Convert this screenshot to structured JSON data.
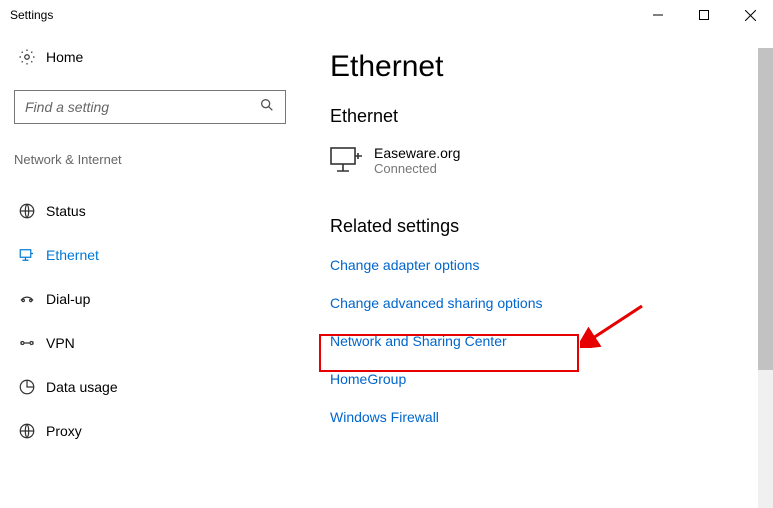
{
  "window_title": "Settings",
  "home_label": "Home",
  "search_placeholder": "Find a setting",
  "category_label": "Network & Internet",
  "nav": [
    {
      "label": "Status",
      "selected": false
    },
    {
      "label": "Ethernet",
      "selected": true
    },
    {
      "label": "Dial-up",
      "selected": false
    },
    {
      "label": "VPN",
      "selected": false
    },
    {
      "label": "Data usage",
      "selected": false
    },
    {
      "label": "Proxy",
      "selected": false
    }
  ],
  "page_title": "Ethernet",
  "section_title": "Ethernet",
  "connection": {
    "name": "Easeware.org",
    "status": "Connected"
  },
  "related_title": "Related settings",
  "links": [
    "Change adapter options",
    "Change advanced sharing options",
    "Network and Sharing Center",
    "HomeGroup",
    "Windows Firewall"
  ]
}
